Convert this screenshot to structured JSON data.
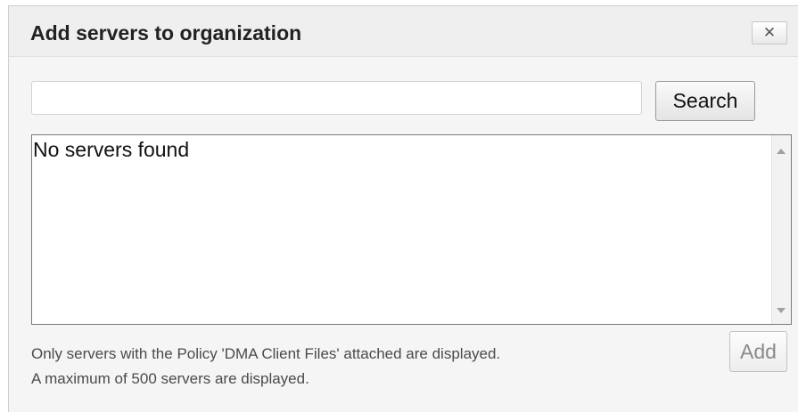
{
  "dialog": {
    "title": "Add servers to organization",
    "close_label": "✕"
  },
  "search": {
    "value": "",
    "placeholder": "",
    "button_label": "Search"
  },
  "results": {
    "empty_text": "No servers found"
  },
  "footer": {
    "note_line1": "Only servers with the Policy 'DMA Client Files' attached are displayed.",
    "note_line2": "A maximum of 500 servers are displayed.",
    "add_label": "Add"
  }
}
